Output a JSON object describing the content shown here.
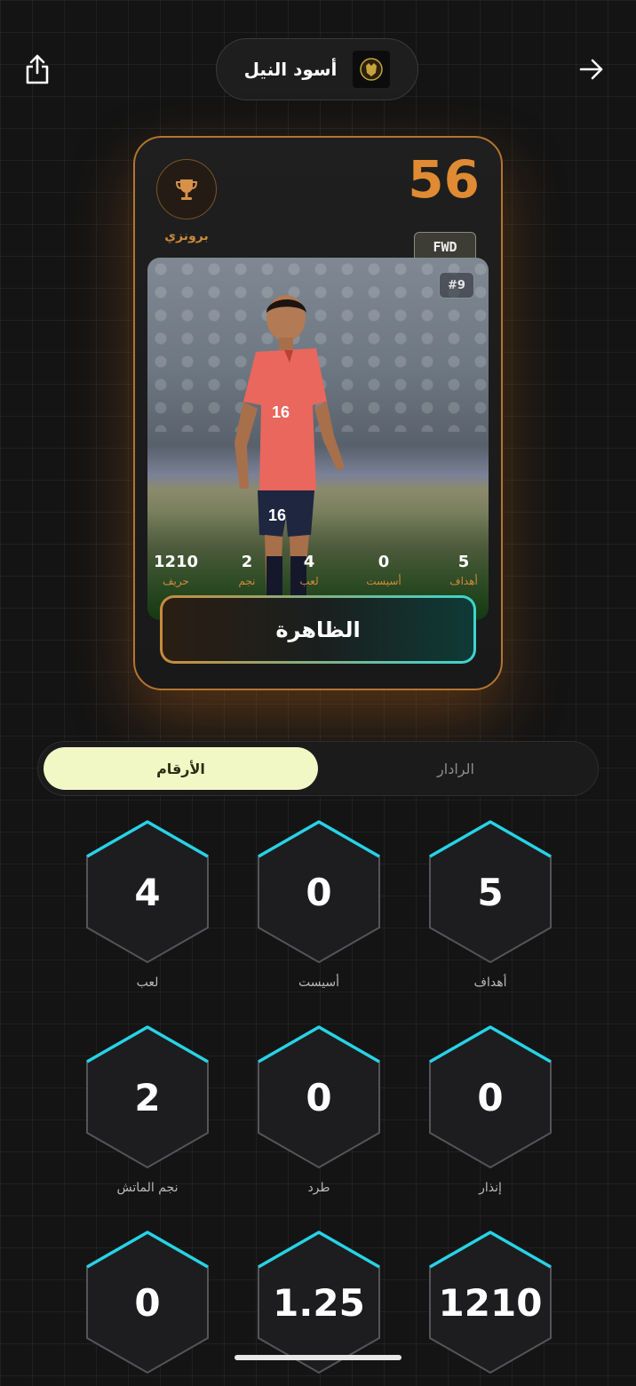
{
  "header": {
    "team_name": "أسود النيل",
    "share_icon": "share-icon",
    "back_icon": "arrow-right-icon",
    "team_logo_icon": "lion-crest-icon"
  },
  "card": {
    "rating": "56",
    "tier": "برونزي",
    "tier_icon": "trophy-icon",
    "position": "FWD",
    "jersey_number": "#9",
    "player_name": "الظاهرة",
    "shirt_number_on_photo": "16",
    "mini_stats": [
      {
        "value": "5",
        "label": "أهداف"
      },
      {
        "value": "0",
        "label": "أسيست"
      },
      {
        "value": "4",
        "label": "لعب"
      },
      {
        "value": "2",
        "label": "نجم"
      },
      {
        "value": "1210",
        "label": "حريف"
      }
    ],
    "colors": {
      "accent": "#e08a33",
      "teal": "#3bd6d0"
    }
  },
  "tabs": {
    "active": "الأرقام",
    "inactive": "الرادار"
  },
  "stats": [
    {
      "value": "5",
      "label": "أهداف"
    },
    {
      "value": "0",
      "label": "أسيست"
    },
    {
      "value": "4",
      "label": "لعب"
    },
    {
      "value": "0",
      "label": "إنذار"
    },
    {
      "value": "0",
      "label": "طرد"
    },
    {
      "value": "2",
      "label": "نجم الماتش"
    },
    {
      "value": "1210",
      "label": ""
    },
    {
      "value": "1.25",
      "label": ""
    },
    {
      "value": "0",
      "label": ""
    }
  ]
}
